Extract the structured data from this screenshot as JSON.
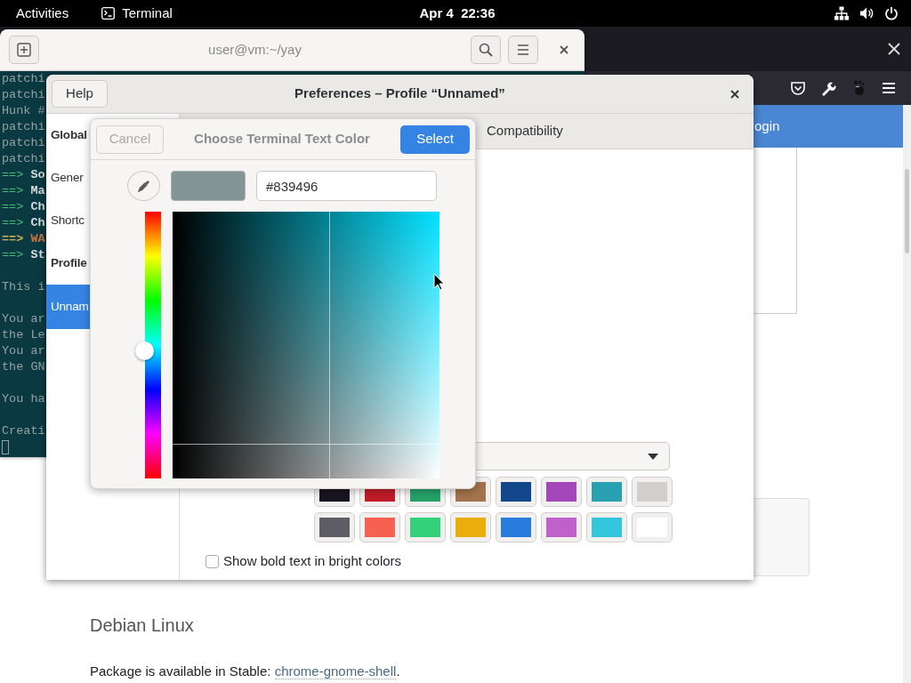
{
  "top_bar": {
    "activities": "Activities",
    "app": "Terminal",
    "clock": "Apr 4  22:36"
  },
  "browser": {
    "banner": "ogin",
    "heading": "Debian Linux",
    "paragraph": {
      "text": "Package is available in Stable: ",
      "link": "chrome-gnome-shell",
      "tail": "."
    }
  },
  "terminal": {
    "title": "user@vm:~/yay",
    "lines": [
      {
        "kind": "plain",
        "text": "patchi"
      },
      {
        "kind": "plain",
        "text": "patchi"
      },
      {
        "kind": "plain",
        "text": "Hunk #"
      },
      {
        "kind": "plain",
        "text": "patchi"
      },
      {
        "kind": "plain",
        "text": "patchi"
      },
      {
        "kind": "plain",
        "text": "patchi"
      },
      {
        "kind": "info",
        "marker": "==>",
        "text": "So"
      },
      {
        "kind": "info",
        "marker": "==>",
        "text": "Ma"
      },
      {
        "kind": "info",
        "marker": "==>",
        "text": "Ch"
      },
      {
        "kind": "info",
        "marker": "==>",
        "text": "Ch"
      },
      {
        "kind": "warning",
        "marker": "==>",
        "text": "WA"
      },
      {
        "kind": "info",
        "marker": "==>",
        "text": "St"
      },
      {
        "kind": "blank"
      },
      {
        "kind": "plain",
        "text": "This i"
      },
      {
        "kind": "blank"
      },
      {
        "kind": "plain",
        "text": "You ar"
      },
      {
        "kind": "plain",
        "text": "the Le"
      },
      {
        "kind": "plain",
        "text": "You ar"
      },
      {
        "kind": "plain",
        "text": "the GN"
      },
      {
        "kind": "blank"
      },
      {
        "kind": "plain",
        "text": "You ha"
      },
      {
        "kind": "blank"
      },
      {
        "kind": "plain",
        "text": "Creati"
      }
    ]
  },
  "preferences": {
    "help": "Help",
    "title": "Preferences – Profile “Unnamed”",
    "sidebar": [
      {
        "kind": "heading",
        "label": "Global",
        "selected": false
      },
      {
        "kind": "item",
        "label": "Gener",
        "selected": false
      },
      {
        "kind": "item",
        "label": "Shortc",
        "selected": false
      },
      {
        "kind": "heading",
        "label": "Profile",
        "selected": false
      },
      {
        "kind": "item",
        "label": "Unnam",
        "selected": true
      }
    ],
    "tabs": [
      {
        "label": "Compatibility",
        "selected": false
      }
    ],
    "palette": [
      {
        "color": "#171421"
      },
      {
        "color": "#c01c28"
      },
      {
        "color": "#26a269"
      },
      {
        "color": "#a2734c"
      },
      {
        "color": "#12488b"
      },
      {
        "color": "#a347ba"
      },
      {
        "color": "#2aa1b3"
      },
      {
        "color": "#d0cfcc"
      },
      {
        "color": "#5e5c64"
      },
      {
        "color": "#f66151"
      },
      {
        "color": "#33d17a"
      },
      {
        "color": "#e9ad0c"
      },
      {
        "color": "#2a7bde"
      },
      {
        "color": "#c061cb"
      },
      {
        "color": "#33c7de"
      },
      {
        "color": "#ffffff"
      }
    ],
    "bold_bright": {
      "label": "Show bold text in bright colors",
      "checked": false
    }
  },
  "color_dialog": {
    "cancel": {
      "label": "Cancel",
      "disabled": true
    },
    "title": "Choose Terminal Text Color",
    "select": "Select",
    "color": "#839496",
    "hex": "#839496",
    "hue": {
      "level": 0.52
    },
    "crosshair": {
      "horizontal": {
        "level": 0.59
      },
      "vertical": {
        "level": 0.13
      }
    }
  }
}
